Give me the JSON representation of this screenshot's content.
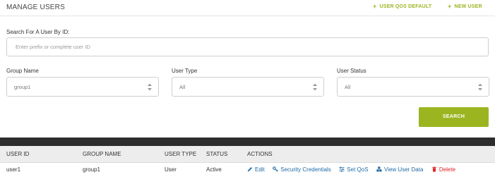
{
  "header": {
    "title": "MANAGE USERS",
    "qos_default_label": "USER QOS DEFAULT",
    "new_user_label": "NEW USER"
  },
  "search": {
    "label": "Search For A User By ID:",
    "placeholder": "Enter prefix or complete user ID",
    "value": ""
  },
  "filters": {
    "group_name": {
      "label": "Group Name",
      "value": "group1"
    },
    "user_type": {
      "label": "User Type",
      "value": "All"
    },
    "user_status": {
      "label": "User Status",
      "value": "All"
    }
  },
  "search_button_label": "SEARCH",
  "colors": {
    "accent": "#9bb521",
    "link": "#1f6aa5",
    "danger": "#e02020",
    "dark_bar": "#2d2d2d",
    "table_header_bg": "#ededed"
  },
  "table": {
    "columns": [
      "USER ID",
      "GROUP NAME",
      "USER TYPE",
      "STATUS",
      "ACTIONS"
    ],
    "rows": [
      {
        "user_id": "user1",
        "group_name": "group1",
        "user_type": "User",
        "status": "Active",
        "actions": [
          {
            "label": "Edit",
            "icon": "pencil-icon"
          },
          {
            "label": "Security Credentials",
            "icon": "key-icon"
          },
          {
            "label": "Set QoS",
            "icon": "sliders-icon"
          },
          {
            "label": "View User Data",
            "icon": "cubes-icon"
          },
          {
            "label": "Delete",
            "icon": "trash-icon"
          }
        ]
      }
    ]
  }
}
